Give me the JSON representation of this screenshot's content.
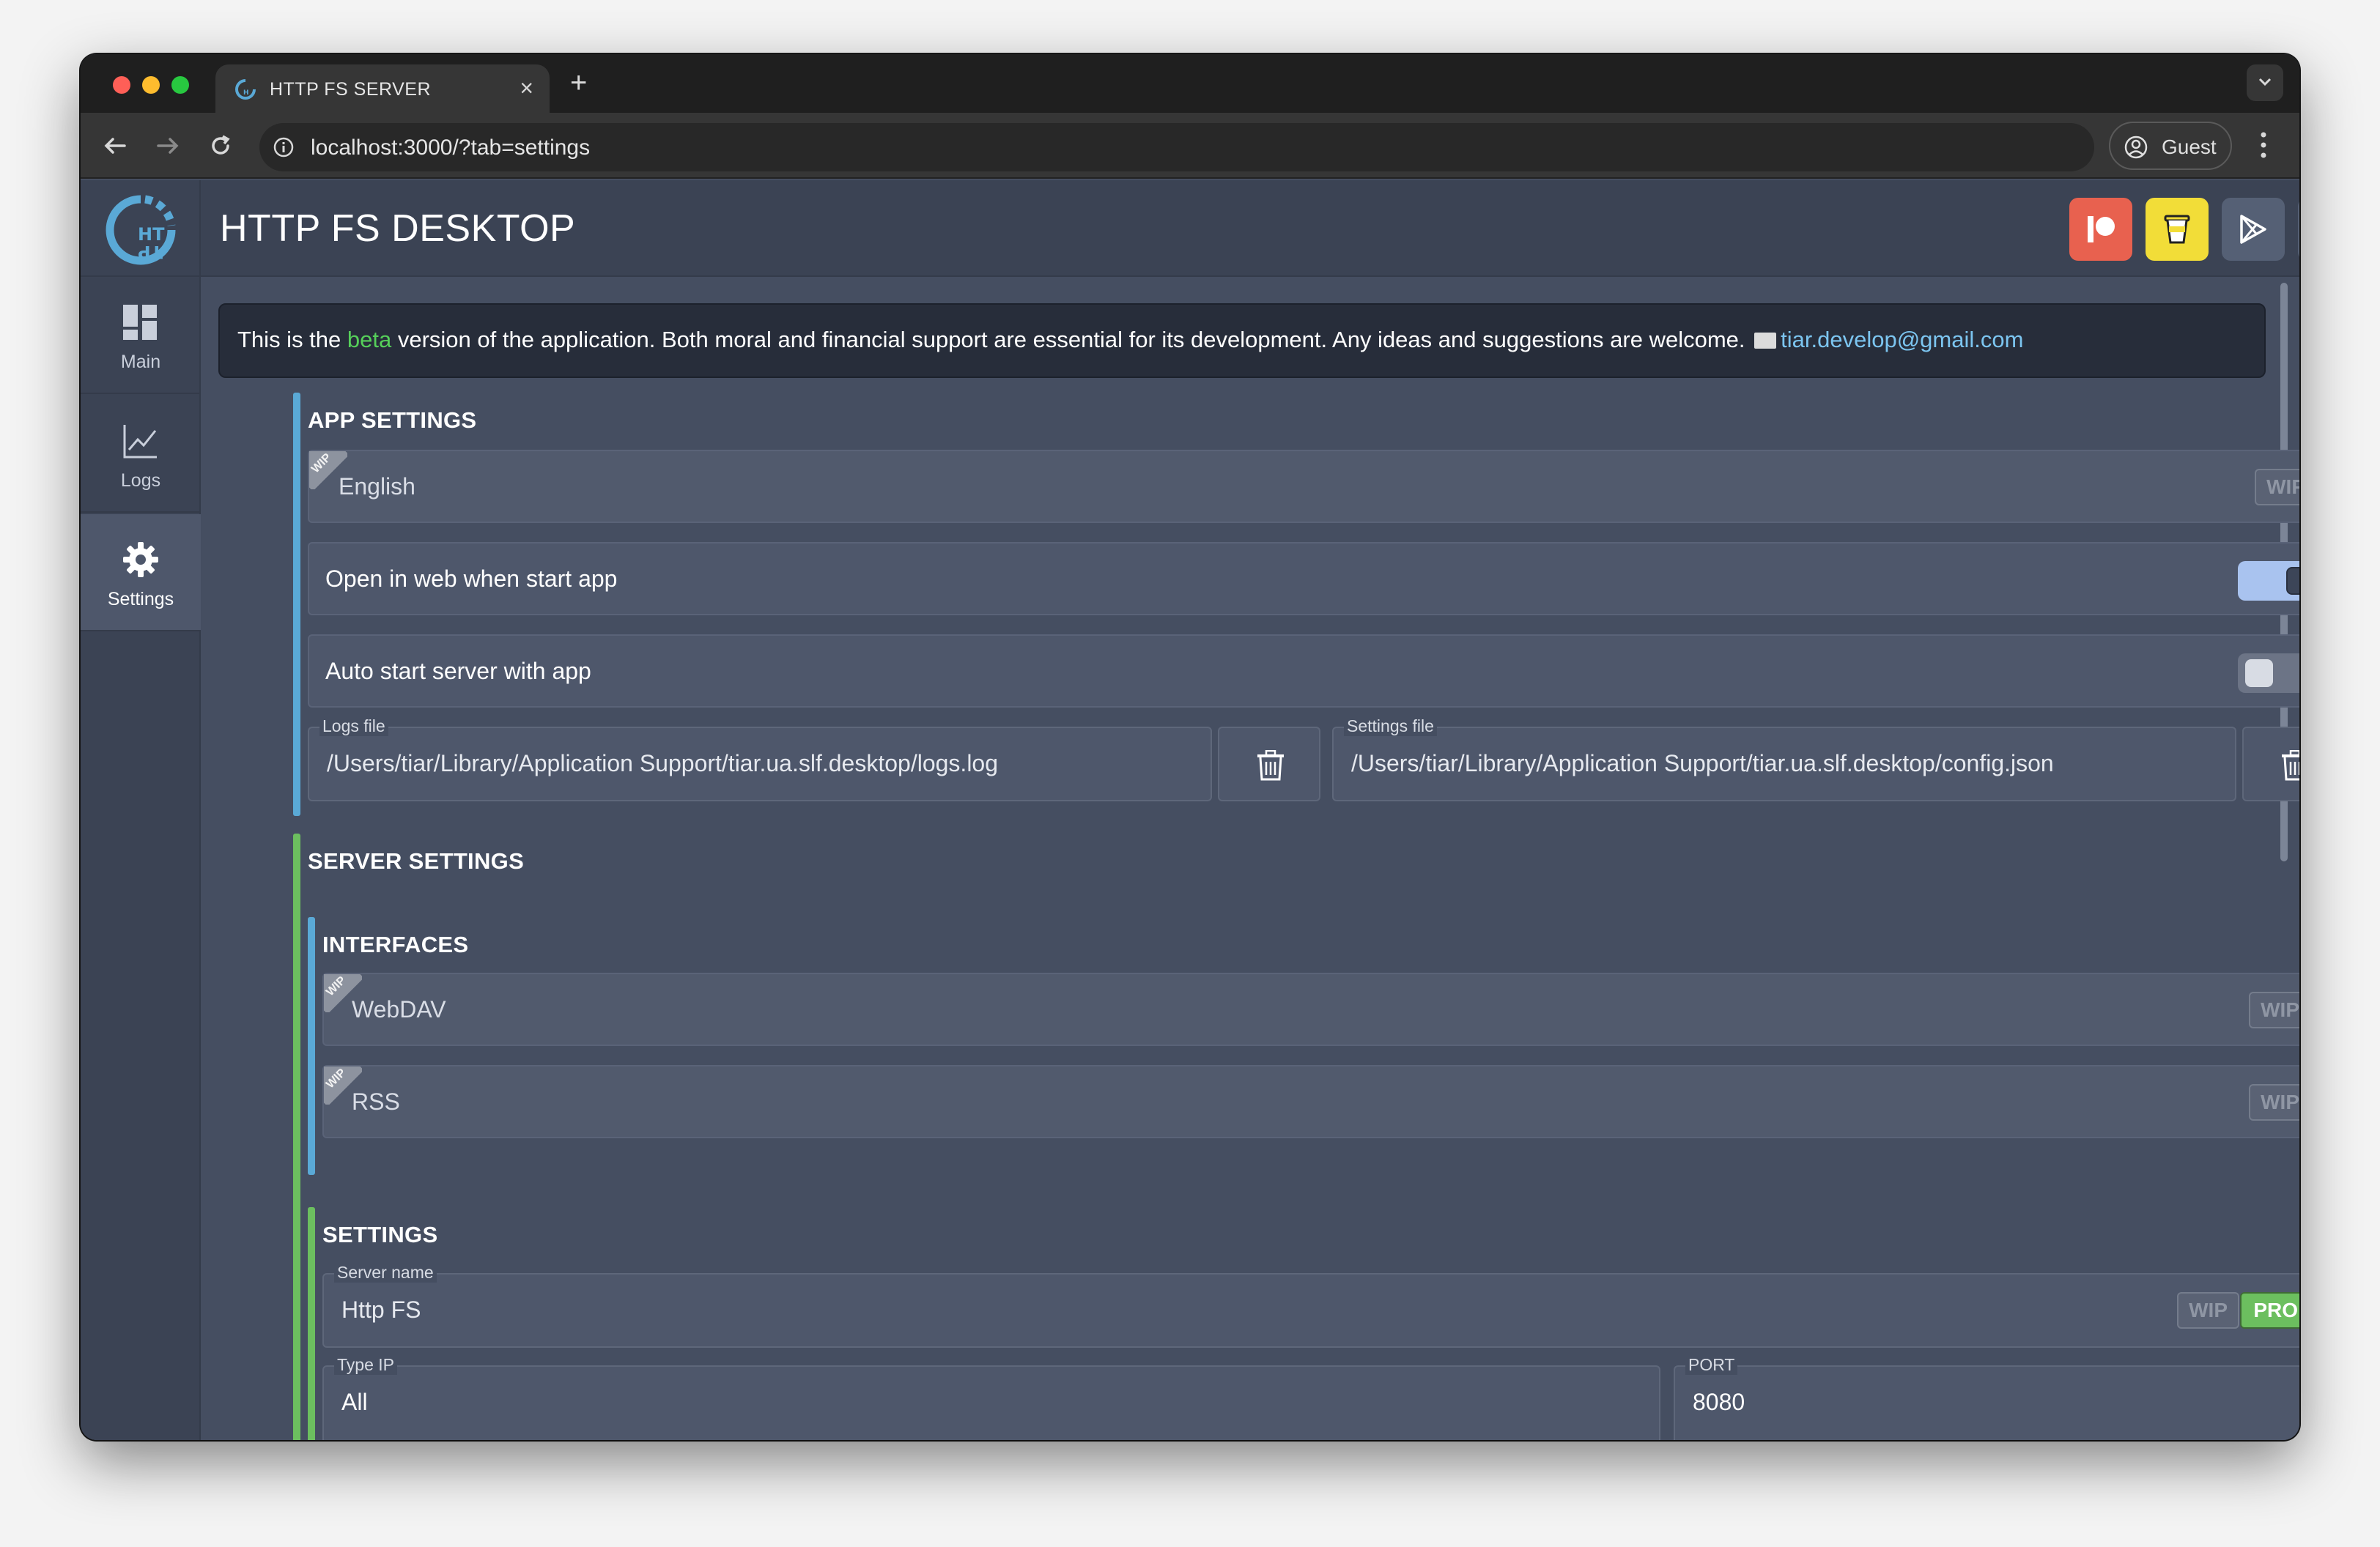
{
  "browser": {
    "tab_title": "HTTP FS SERVER",
    "tab_close": "×",
    "new_tab": "+",
    "url": "localhost:3000/?tab=settings",
    "profile_label": "Guest"
  },
  "app": {
    "title": "HTTP FS DESKTOP",
    "logo_text": "HT TP"
  },
  "sidebar": {
    "items": [
      {
        "label": "Main",
        "icon": "dashboard-icon"
      },
      {
        "label": "Logs",
        "icon": "chart-line-icon"
      },
      {
        "label": "Settings",
        "icon": "gear-icon"
      }
    ]
  },
  "header_buttons": [
    {
      "icon": "patreon-icon",
      "color": "#e8614f"
    },
    {
      "icon": "coffee-cup-icon",
      "color": "#f2dd38"
    },
    {
      "icon": "google-play-icon",
      "color": "#556075"
    },
    {
      "icon": "github-icon",
      "color": "#556075"
    }
  ],
  "beta_notice": {
    "prefix": "This is the ",
    "highlight": "beta",
    "body": " version of the application. Both moral and financial support are essential for its development. Any ideas and suggestions are welcome. ",
    "email": "tiar.develop@gmail.com"
  },
  "app_settings": {
    "title": "APP SETTINGS",
    "language": {
      "value": "English",
      "ribbon": "WIP",
      "badge": "WIP"
    },
    "open_in_web": {
      "label": "Open in web when start app",
      "enabled": true
    },
    "auto_start": {
      "label": "Auto start server with app",
      "enabled": false
    },
    "logs_file": {
      "label": "Logs file",
      "value": "/Users/tiar/Library/Application Support/tiar.ua.slf.desktop/logs.log"
    },
    "settings_file": {
      "label": "Settings file",
      "value": "/Users/tiar/Library/Application Support/tiar.ua.slf.desktop/config.json"
    }
  },
  "server_settings": {
    "title": "SERVER SETTINGS",
    "interfaces": {
      "title": "INTERFACES",
      "items": [
        {
          "label": "WebDAV",
          "ribbon": "WIP",
          "badge": "WIP"
        },
        {
          "label": "RSS",
          "ribbon": "WIP",
          "badge": "WIP"
        }
      ]
    },
    "settings": {
      "title": "SETTINGS",
      "server_name": {
        "label": "Server name",
        "value": "Http FS",
        "badge_wip": "WIP",
        "badge_pro": "PRO"
      },
      "type_ip": {
        "label": "Type IP",
        "value": "All"
      },
      "port": {
        "label": "PORT",
        "value": "8080"
      }
    }
  },
  "colors": {
    "accent_blue": "#5aa9d6",
    "accent_green": "#6cbf5f",
    "beta_green": "#56d05a",
    "link_blue": "#7cc5f0"
  }
}
